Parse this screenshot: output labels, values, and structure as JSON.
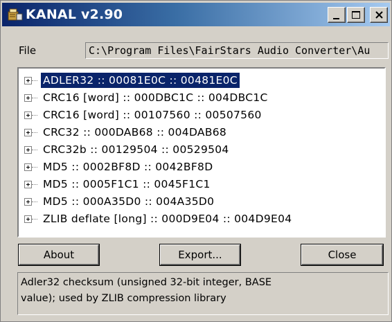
{
  "window": {
    "title": "KANAL v2.90",
    "accent_color": "#0a246a",
    "icon": "kanal-app-icon"
  },
  "file": {
    "label": "File",
    "path": "C:\\Program Files\\FairStars Audio Converter\\Au"
  },
  "tree": {
    "items": [
      {
        "label": "ADLER32 :: 00081E0C :: 00481E0C",
        "selected": true
      },
      {
        "label": "CRC16 [word] :: 000DBC1C :: 004DBC1C",
        "selected": false
      },
      {
        "label": "CRC16 [word] :: 00107560 :: 00507560",
        "selected": false
      },
      {
        "label": "CRC32 :: 000DAB68 :: 004DAB68",
        "selected": false
      },
      {
        "label": "CRC32b :: 00129504 :: 00529504",
        "selected": false
      },
      {
        "label": "MD5 :: 0002BF8D :: 0042BF8D",
        "selected": false
      },
      {
        "label": "MD5 :: 0005F1C1 :: 0045F1C1",
        "selected": false
      },
      {
        "label": "MD5 :: 000A35D0 :: 004A35D0",
        "selected": false
      },
      {
        "label": "ZLIB deflate [long] :: 000D9E04 :: 004D9E04",
        "selected": false
      }
    ]
  },
  "buttons": {
    "about": "About",
    "export": "Export...",
    "close": "Close"
  },
  "status": {
    "line1": "Adler32 checksum (unsigned 32-bit integer, BASE",
    "line2": "value); used by ZLIB compression library"
  }
}
